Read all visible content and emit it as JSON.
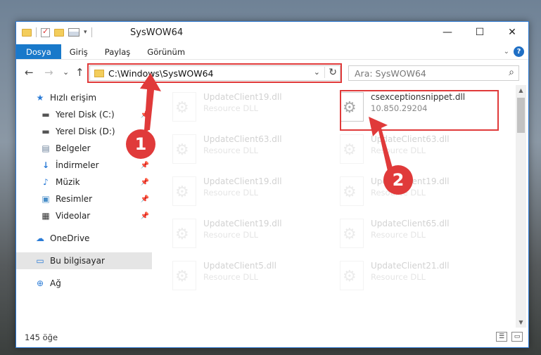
{
  "window": {
    "title": "SysWOW64",
    "minimize_label": "—",
    "maximize_label": "☐",
    "close_label": "✕"
  },
  "ribbon": {
    "tabs": [
      "Dosya",
      "Giriş",
      "Paylaş",
      "Görünüm"
    ],
    "expand_label": "⌄",
    "help_label": "?"
  },
  "nav": {
    "back": "←",
    "forward": "→",
    "recent": "⌄",
    "up": "↑",
    "address": "C:\\Windows\\SysWOW64",
    "address_dropdown": "⌄",
    "refresh": "↻",
    "search_placeholder": "Ara: SysWOW64",
    "search_icon": "⌕"
  },
  "sidebar": {
    "items": [
      {
        "label": "Hızlı erişim",
        "icon": "★"
      },
      {
        "label": "Yerel Disk (C:)",
        "icon": "▬"
      },
      {
        "label": "Yerel Disk (D:)",
        "icon": "▬"
      },
      {
        "label": "Belgeler",
        "icon": "▤"
      },
      {
        "label": "İndirmeler",
        "icon": "↓"
      },
      {
        "label": "Müzik",
        "icon": "♪"
      },
      {
        "label": "Resimler",
        "icon": "▣"
      },
      {
        "label": "Videolar",
        "icon": "▦"
      },
      {
        "label": "OneDrive",
        "icon": "☁"
      },
      {
        "label": "Bu bilgisayar",
        "icon": "▭"
      },
      {
        "label": "Ağ",
        "icon": "⊕"
      }
    ],
    "pin_glyph": "📌"
  },
  "files": [
    {
      "name": "UpdateClient19.dll",
      "type": "Resource DLL"
    },
    {
      "name": "csexceptionsnippet.dll",
      "type": "10.850.29204"
    },
    {
      "name": "UpdateClient63.dll",
      "type": "Resource DLL"
    },
    {
      "name": "UpdateClient63.dll",
      "type": "Resource DLL"
    },
    {
      "name": "UpdateClient19.dll",
      "type": "Resource DLL"
    },
    {
      "name": "UpdateClient19.dll",
      "type": "Resource DLL"
    },
    {
      "name": "UpdateClient19.dll",
      "type": "Resource DLL"
    },
    {
      "name": "UpdateClient65.dll",
      "type": "Resource DLL"
    },
    {
      "name": "UpdateClient5.dll",
      "type": "Resource DLL"
    },
    {
      "name": "UpdateClient21.dll",
      "type": "Resource DLL"
    }
  ],
  "status": {
    "count": "145 öğe"
  },
  "markers": [
    "1",
    "2"
  ],
  "colors": {
    "accent": "#1979ca",
    "highlight": "#e03a3a"
  }
}
